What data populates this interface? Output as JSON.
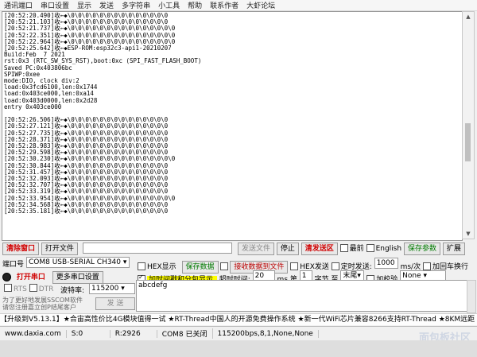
{
  "menu": [
    "通讯端口",
    "串口设置",
    "显示",
    "发送",
    "多字符串",
    "小工具",
    "帮助",
    "联系作者",
    "大虾论坛"
  ],
  "terminal": {
    "lines": [
      "[20:52:20.490]收←◆\\0\\0\\0\\0\\0\\0\\0\\0\\0\\0\\0\\0\\0\\0",
      "[20:52:21.103]收←◆\\0\\0\\0\\0\\0\\0\\0\\0\\0\\0\\0\\0\\0\\0",
      "[20:52:21.737]收←◆\\0\\0\\0\\0\\0\\0\\0\\0\\0\\0\\0\\0\\0\\0\\0",
      "[20:52:22.351]收←◆\\0\\0\\0\\0\\0\\0\\0\\0\\0\\0\\0\\0\\0\\0\\0",
      "[20:52:22.964]收←◆\\0\\0\\0\\0\\0\\0\\0\\0\\0\\0\\0\\0\\0\\0\\0",
      "[20:52:25.642]收←◆ESP-ROM:esp32c3-api1-20210207",
      "Build:Feb  7 2021",
      "rst:0x3 (RTC_SW_SYS_RST),boot:0xc (SPI_FAST_FLASH_BOOT)",
      "Saved PC:0x403806bc",
      "SPIWP:0xee",
      "mode:DIO, clock div:2",
      "load:0x3fcd6100,len:0x1744",
      "load:0x403ce000,len:0xa14",
      "load:0x403d0000,len:0x2d28",
      "entry 0x403ce000",
      "",
      "[20:52:26.506]收←◆\\0\\0\\0\\0\\0\\0\\0\\0\\0\\0\\0\\0\\0\\0",
      "[20:52:27.121]收←◆\\0\\0\\0\\0\\0\\0\\0\\0\\0\\0\\0\\0\\0\\0",
      "[20:52:27.735]收←◆\\0\\0\\0\\0\\0\\0\\0\\0\\0\\0\\0\\0\\0\\0",
      "[20:52:28.371]收←◆\\0\\0\\0\\0\\0\\0\\0\\0\\0\\0\\0\\0\\0\\0",
      "[20:52:28.983]收←◆\\0\\0\\0\\0\\0\\0\\0\\0\\0\\0\\0\\0\\0\\0",
      "[20:52:29.598]收←◆\\0\\0\\0\\0\\0\\0\\0\\0\\0\\0\\0\\0\\0\\0",
      "[20:52:30.230]收←◆\\0\\0\\0\\0\\0\\0\\0\\0\\0\\0\\0\\0\\0\\0\\0",
      "[20:52:30.844]收←◆\\0\\0\\0\\0\\0\\0\\0\\0\\0\\0\\0\\0\\0\\0",
      "[20:52:31.457]收←◆\\0\\0\\0\\0\\0\\0\\0\\0\\0\\0\\0\\0\\0\\0",
      "[20:52:32.093]收←◆\\0\\0\\0\\0\\0\\0\\0\\0\\0\\0\\0\\0\\0\\0",
      "[20:52:32.707]收←◆\\0\\0\\0\\0\\0\\0\\0\\0\\0\\0\\0\\0\\0\\0",
      "[20:52:33.319]收←◆\\0\\0\\0\\0\\0\\0\\0\\0\\0\\0\\0\\0\\0\\0",
      "[20:52:33.954]收←◆\\0\\0\\0\\0\\0\\0\\0\\0\\0\\0\\0\\0\\0\\0\\0",
      "[20:52:34.568]收←◆\\0\\0\\0\\0\\0\\0\\0\\0\\0\\0\\0\\0\\0\\0",
      "[20:52:35.181]收←◆\\0\\0\\0\\0\\0\\0\\0\\0\\0\\0\\0\\0\\0\\0"
    ]
  },
  "toolbar": {
    "clear_window": "清除窗口",
    "open_file": "打开文件",
    "send_file": "发送文件",
    "stop": "停止",
    "clear_send": "清发送区",
    "last": "最前",
    "english": "English",
    "save_params": "保存参数",
    "expand": "扩展"
  },
  "port": {
    "port_label": "端口号",
    "port_value": "COM8 USB-SERIAL CH340",
    "hex_display": "HEX显示",
    "save_data": "保存数据",
    "recv_to_file": "接收数据到文件",
    "hex_send": "HEX发送",
    "timed_send": "定时发送:",
    "interval": "1000",
    "interval_unit": "ms/次",
    "add_crlf": "加回车换行",
    "close_port": "打开串口",
    "more_settings": "更多串口设置",
    "timestamp_label": "加时间戳和分包显示.",
    "timeout_label": "超时时间:",
    "timeout_value": "20",
    "ms": "ms",
    "nth": "第",
    "nth_value": "1",
    "byte_label": "字节 至",
    "end_value": "末尾",
    "checksum_label": "加校验",
    "checksum_value": "None",
    "rts": "RTS",
    "dtr": "DTR",
    "baud_label": "波特率:",
    "baud_value": "115200",
    "send_text": "abcdefg",
    "send_button": "发 送",
    "promo_line1": "为了更好地发展SSCOM软件",
    "promo_line2": "请您注册嘉立创P结尾客户"
  },
  "ticker": "【升级到V5.13.1】★合宙高性价比4G模块值得一试 ★RT-Thread中国人的开源免费操作系统 ★新一代WiFi芯片兼容8266支持RT-Thread ★8KM远距",
  "status": {
    "site": "www.daxia.com",
    "s": "S:0",
    "r": "R:2926",
    "com": "COM8 已关闭",
    "params": "115200bps,8,1,None,None"
  },
  "watermark": "面包板社区"
}
